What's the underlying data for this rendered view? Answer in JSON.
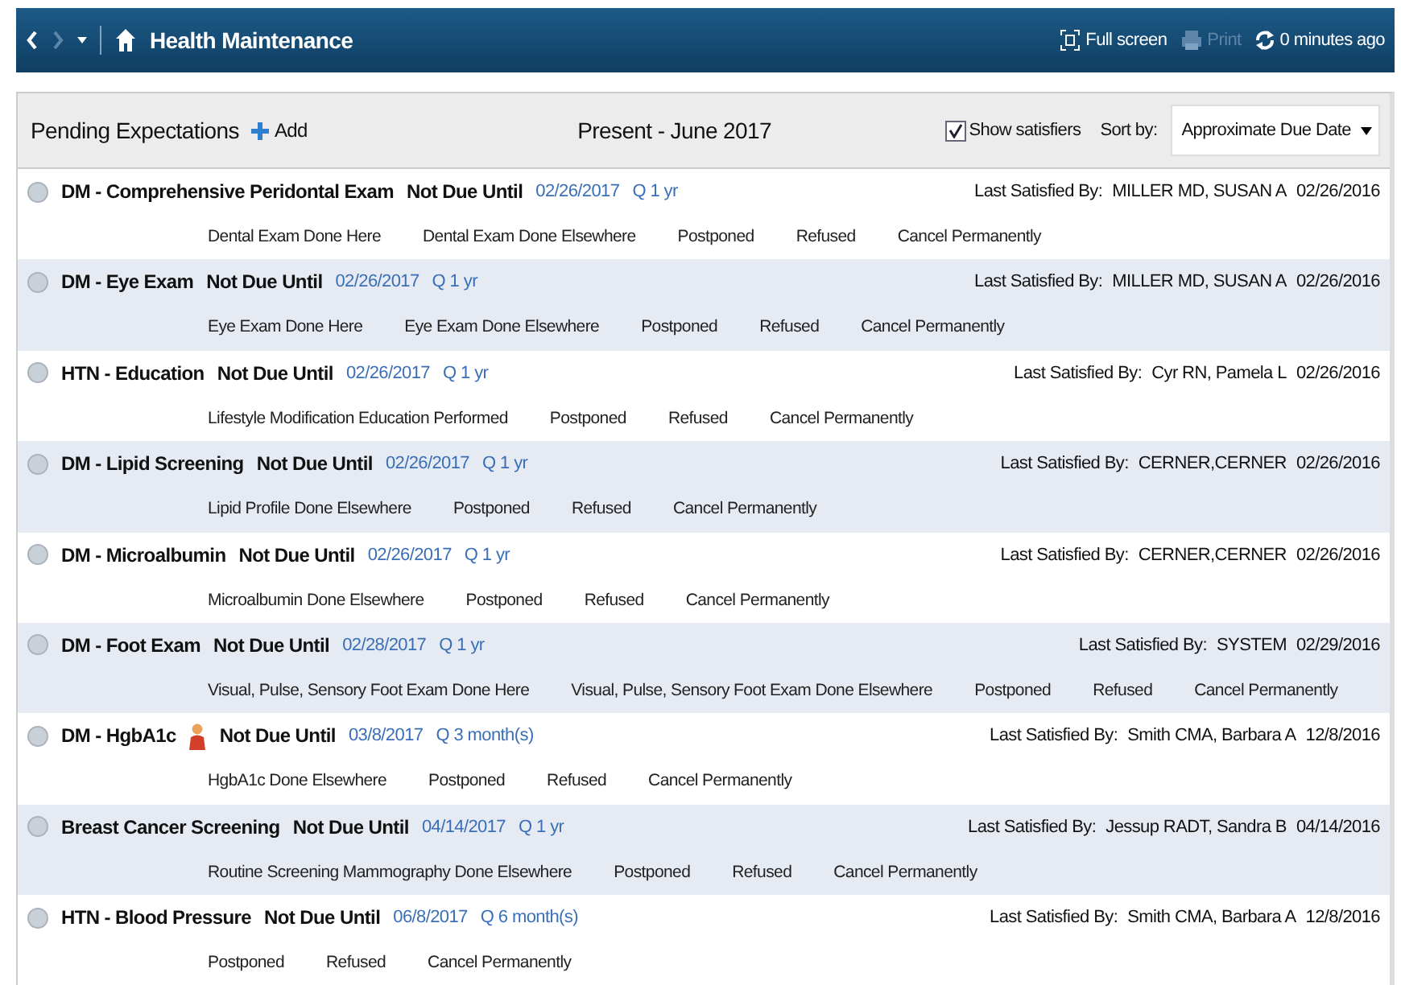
{
  "header": {
    "title": "Health Maintenance",
    "full_screen": "Full screen",
    "print": {
      "label": "Print",
      "disabled": true
    },
    "refresh": "0 minutes ago"
  },
  "toolbar": {
    "title": "Pending Expectations",
    "add": "Add",
    "range": "Present - June 2017",
    "show_satisfiers": {
      "label": "Show satisfiers",
      "checked": true
    },
    "sort_label": "Sort by:",
    "sort_value": "Approximate Due Date"
  },
  "expectations": [
    {
      "name": "DM - Comprehensive Peridontal Exam",
      "status": "Not Due Until",
      "due": "02/26/2017",
      "frequency": "Q 1 yr",
      "last_label": "Last Satisfied By:",
      "last_by": "MILLER MD, SUSAN A",
      "last_date": "02/26/2016",
      "actions": [
        "Dental Exam Done Here",
        "Dental Exam Done Elsewhere",
        "Postponed",
        "Refused",
        "Cancel Permanently"
      ]
    },
    {
      "name": "DM - Eye Exam",
      "status": "Not Due Until",
      "due": "02/26/2017",
      "frequency": "Q 1 yr",
      "last_label": "Last Satisfied By:",
      "last_by": "MILLER MD, SUSAN A",
      "last_date": "02/26/2016",
      "actions": [
        "Eye Exam Done Here",
        "Eye Exam Done Elsewhere",
        "Postponed",
        "Refused",
        "Cancel Permanently"
      ]
    },
    {
      "name": "HTN - Education",
      "status": "Not Due Until",
      "due": "02/26/2017",
      "frequency": "Q 1 yr",
      "last_label": "Last Satisfied By:",
      "last_by": "Cyr RN, Pamela L",
      "last_date": "02/26/2016",
      "actions": [
        "Lifestyle Modification Education Performed",
        "Postponed",
        "Refused",
        "Cancel Permanently"
      ]
    },
    {
      "name": "DM - Lipid Screening",
      "status": "Not Due Until",
      "due": "02/26/2017",
      "frequency": "Q 1 yr",
      "last_label": "Last Satisfied By:",
      "last_by": "CERNER,CERNER",
      "last_date": "02/26/2016",
      "actions": [
        "Lipid Profile Done Elsewhere",
        "Postponed",
        "Refused",
        "Cancel Permanently"
      ]
    },
    {
      "name": "DM - Microalbumin",
      "status": "Not Due Until",
      "due": "02/26/2017",
      "frequency": "Q 1 yr",
      "last_label": "Last Satisfied By:",
      "last_by": "CERNER,CERNER",
      "last_date": "02/26/2016",
      "actions": [
        "Microalbumin Done Elsewhere",
        "Postponed",
        "Refused",
        "Cancel Permanently"
      ]
    },
    {
      "name": "DM - Foot Exam",
      "status": "Not Due Until",
      "due": "02/28/2017",
      "frequency": "Q 1 yr",
      "last_label": "Last Satisfied By:",
      "last_by": "SYSTEM",
      "last_date": "02/29/2016",
      "actions": [
        "Visual, Pulse, Sensory Foot Exam Done Here",
        "Visual, Pulse, Sensory Foot Exam Done Elsewhere",
        "Postponed",
        "Refused",
        "Cancel Permanently"
      ]
    },
    {
      "name": "DM - HgbA1c",
      "person_icon": true,
      "status": "Not Due Until",
      "due": "03/8/2017",
      "frequency": "Q 3 month(s)",
      "last_label": "Last Satisfied By:",
      "last_by": "Smith CMA, Barbara A",
      "last_date": "12/8/2016",
      "actions": [
        "HgbA1c Done Elsewhere",
        "Postponed",
        "Refused",
        "Cancel Permanently"
      ]
    },
    {
      "name": "Breast Cancer Screening",
      "status": "Not Due Until",
      "due": "04/14/2017",
      "frequency": "Q 1 yr",
      "last_label": "Last Satisfied By:",
      "last_by": "Jessup RADT, Sandra B",
      "last_date": "04/14/2016",
      "actions": [
        "Routine Screening Mammography Done Elsewhere",
        "Postponed",
        "Refused",
        "Cancel Permanently"
      ]
    },
    {
      "name": "HTN - Blood Pressure",
      "status": "Not Due Until",
      "due": "06/8/2017",
      "frequency": "Q 6 month(s)",
      "last_label": "Last Satisfied By:",
      "last_by": "Smith CMA, Barbara A",
      "last_date": "12/8/2016",
      "actions": [
        "Postponed",
        "Refused",
        "Cancel Permanently"
      ]
    }
  ]
}
